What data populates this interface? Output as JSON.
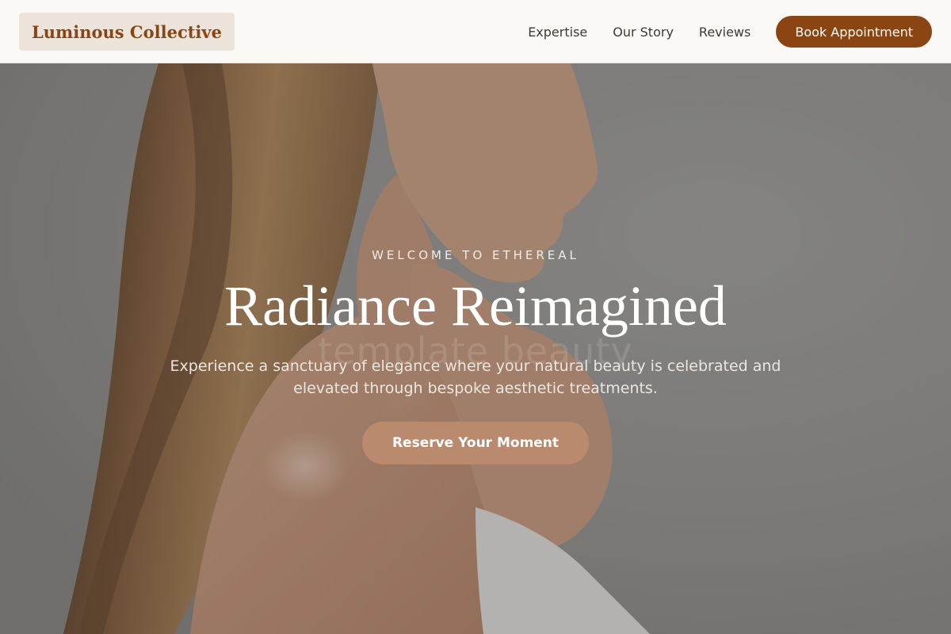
{
  "header": {
    "logo_text": "Luminous Collective",
    "nav": [
      {
        "label": "Expertise"
      },
      {
        "label": "Our Story"
      },
      {
        "label": "Reviews"
      }
    ],
    "cta_label": "Book Appointment"
  },
  "hero": {
    "eyebrow": "WELCOME TO ETHEREAL",
    "headline": "Radiance Reimagined",
    "subtitle": "Experience a sanctuary of elegance where your natural beauty is celebrated and elevated through bespoke aesthetic treatments.",
    "cta_label": "Reserve Your Moment",
    "watermark": "template beauty"
  },
  "colors": {
    "brand": "#8b4513",
    "cta_hero": "#b98a6e",
    "header_bg": "#faf9f5",
    "logo_bg": "#ece3da"
  }
}
